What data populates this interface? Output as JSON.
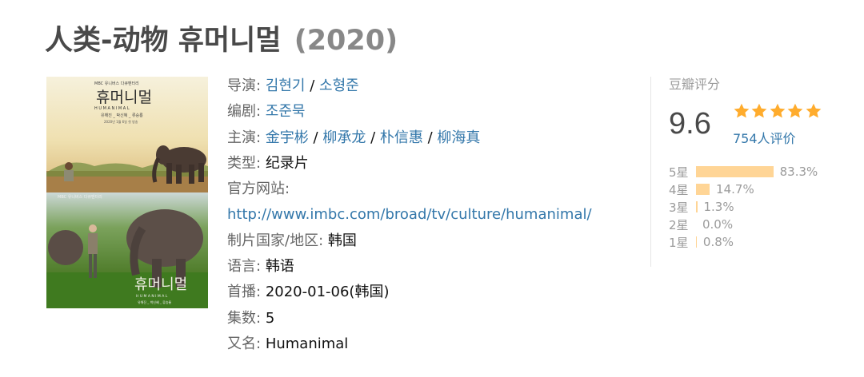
{
  "title": "人类-动物 휴머니멀",
  "year": "(2020)",
  "poster": {
    "top": {
      "logo": "MBC 유니버스 다큐멘터리",
      "title": "휴머니멀",
      "subtitle": "H U M A N I M A L",
      "credits": "유해진 _ 박신혜 _ 류승룡",
      "date": "2020년 1월 6일 첫 방송"
    },
    "bottom": {
      "logo": "MBC 유니버스 다큐멘터리",
      "title": "휴머니멀",
      "subtitle": "H U M A N I M A L",
      "credits": "유해진 _ 박신혜 _ 류승룡"
    }
  },
  "info": {
    "director_label": "导演",
    "directors": [
      "김현기",
      "소형준"
    ],
    "writer_label": "编剧",
    "writers": [
      "조준묵"
    ],
    "cast_label": "主演",
    "cast": [
      "金宇彬",
      "柳承龙",
      "朴信惠",
      "柳海真"
    ],
    "genre_label": "类型:",
    "genre": "纪录片",
    "website_label": "官方网站:",
    "website": "http://www.imbc.com/broad/tv/culture/humanimal/",
    "country_label": "制片国家/地区:",
    "country": "韩国",
    "language_label": "语言:",
    "language": "韩语",
    "premiere_label": "首播:",
    "premiere": "2020-01-06(韩国)",
    "episodes_label": "集数:",
    "episodes": "5",
    "aka_label": "又名:",
    "aka": "Humanimal"
  },
  "rating": {
    "label": "豆瓣评分",
    "score": "9.6",
    "stars": 5,
    "votes": "754人评价",
    "star_color": "#ffac2d",
    "distribution": [
      {
        "label": "5星",
        "percent": "83.3%",
        "value": 83.3
      },
      {
        "label": "4星",
        "percent": "14.7%",
        "value": 14.7
      },
      {
        "label": "3星",
        "percent": "1.3%",
        "value": 1.3
      },
      {
        "label": "2星",
        "percent": "0.0%",
        "value": 0.0
      },
      {
        "label": "1星",
        "percent": "0.8%",
        "value": 0.8
      }
    ]
  }
}
